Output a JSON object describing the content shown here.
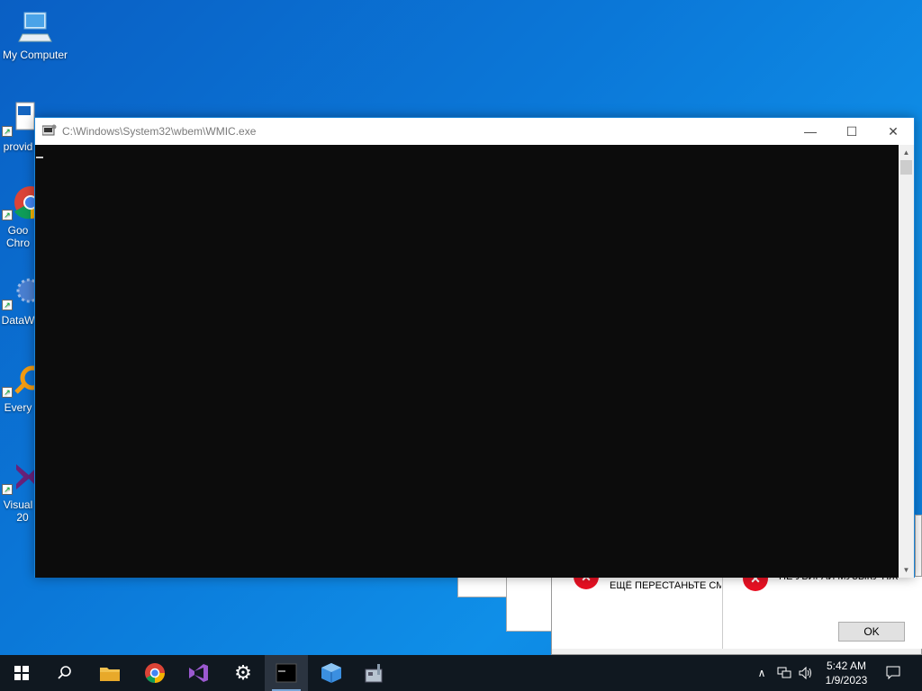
{
  "desktop": {
    "icons": [
      {
        "name": "my-computer",
        "label": "My Computer"
      },
      {
        "name": "provider",
        "label": "provid"
      },
      {
        "name": "google-chrome",
        "label": "Goo\nChro"
      },
      {
        "name": "datawarrior",
        "label": "DataW"
      },
      {
        "name": "everything",
        "label": "Every"
      },
      {
        "name": "visual-studio",
        "label": "Visual\n20"
      }
    ]
  },
  "console": {
    "title": "C:\\Windows\\System32\\wbem\\WMIC.exe",
    "minimize": "—",
    "maximize": "☐",
    "close": "✕"
  },
  "background_dialogs": {
    "message_left": "ЕЩЁ ПЕРЕСТАНЬТЕ СМО",
    "message_right": "НЕ УБИРАЙ МУЗЫКУ НЖ",
    "ok_label": "OK"
  },
  "taskbar": {
    "items": [
      "start",
      "search",
      "file-explorer",
      "google-chrome",
      "visual-studio",
      "settings",
      "console",
      "package",
      "installer"
    ]
  },
  "tray": {
    "time": "5:42 AM",
    "date": "1/9/2023"
  },
  "colors": {
    "accent": "#1883d7",
    "error": "#e81123",
    "console_bg": "#0c0c0c"
  }
}
